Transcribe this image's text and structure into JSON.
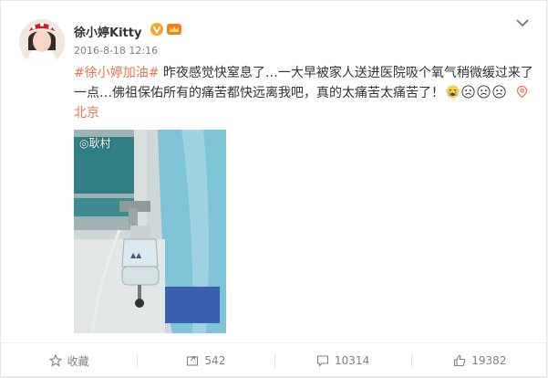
{
  "post": {
    "user": {
      "name": "徐小婷Kitty",
      "verified_icon": "verified-v-icon",
      "member_icon": "member-crown-icon"
    },
    "timestamp": "2016-8-18 12:16",
    "hashtag": "#徐小婷加油#",
    "text_part1": " 昨夜感觉快窒息了…一大早被家人送进医院吸个氧气稍微缓过来了一点…佛祖保佑所有的痛苦都快远离我吧，真的太痛苦太痛苦了！",
    "emojis": [
      "crying-emoji",
      "sad-emoji",
      "sad-emoji",
      "sad-emoji"
    ],
    "location": "北京",
    "location_icon": "location-pin-icon",
    "photo_watermark": "◎耿村",
    "photo_subject": "hospital oxygen humidifier bottle"
  },
  "actions": {
    "favorite": {
      "label": "收藏",
      "icon": "star-icon"
    },
    "repost": {
      "label": "542",
      "icon": "repost-icon"
    },
    "comment": {
      "label": "10314",
      "icon": "comment-icon"
    },
    "like": {
      "label": "19382",
      "icon": "thumb-up-icon"
    }
  },
  "colors": {
    "link": "#eb7350",
    "verified": "#f5a623",
    "text": "#333333",
    "muted": "#808080"
  }
}
